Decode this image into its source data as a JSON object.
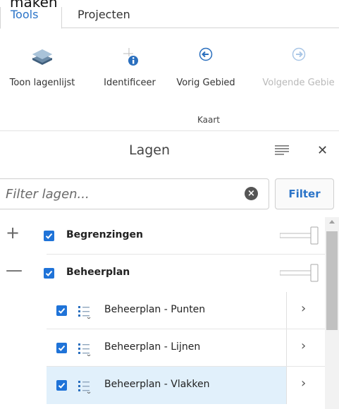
{
  "top_cutoff_text": "maken",
  "ribbon": {
    "tabs": [
      {
        "label": "Tools"
      },
      {
        "label": "Projecten"
      }
    ],
    "tools": [
      {
        "label": "Toon lagenlijst",
        "icon": "layers-icon"
      },
      {
        "label": "Identificeer",
        "icon": "identify-info-icon"
      },
      {
        "label": "Vorig Gebied",
        "icon": "previous-extent-icon"
      },
      {
        "label": "Volgende Gebie",
        "icon": "next-extent-icon"
      }
    ],
    "group_label": "Kaart"
  },
  "panel": {
    "title": "Lagen",
    "close_glyph": "✕",
    "filter": {
      "placeholder": "Filter lagen...",
      "button_label": "Filter"
    },
    "expand_glyphs": {
      "collapsed": "+",
      "expanded": "—"
    },
    "chevron_glyph": "›",
    "layers": [
      {
        "label": "Begrenzingen",
        "checked": true,
        "expanded": false
      },
      {
        "label": "Beheerplan",
        "checked": true,
        "expanded": true,
        "children": [
          {
            "label": "Beheerplan - Punten",
            "checked": true
          },
          {
            "label": "Beheerplan - Lijnen",
            "checked": true
          },
          {
            "label": "Beheerplan - Vlakken",
            "checked": true,
            "selected": true
          }
        ]
      }
    ]
  },
  "colors": {
    "accent": "#2b74c8",
    "checkbox": "#1f73d8",
    "selected_row": "#e1f0fb"
  }
}
